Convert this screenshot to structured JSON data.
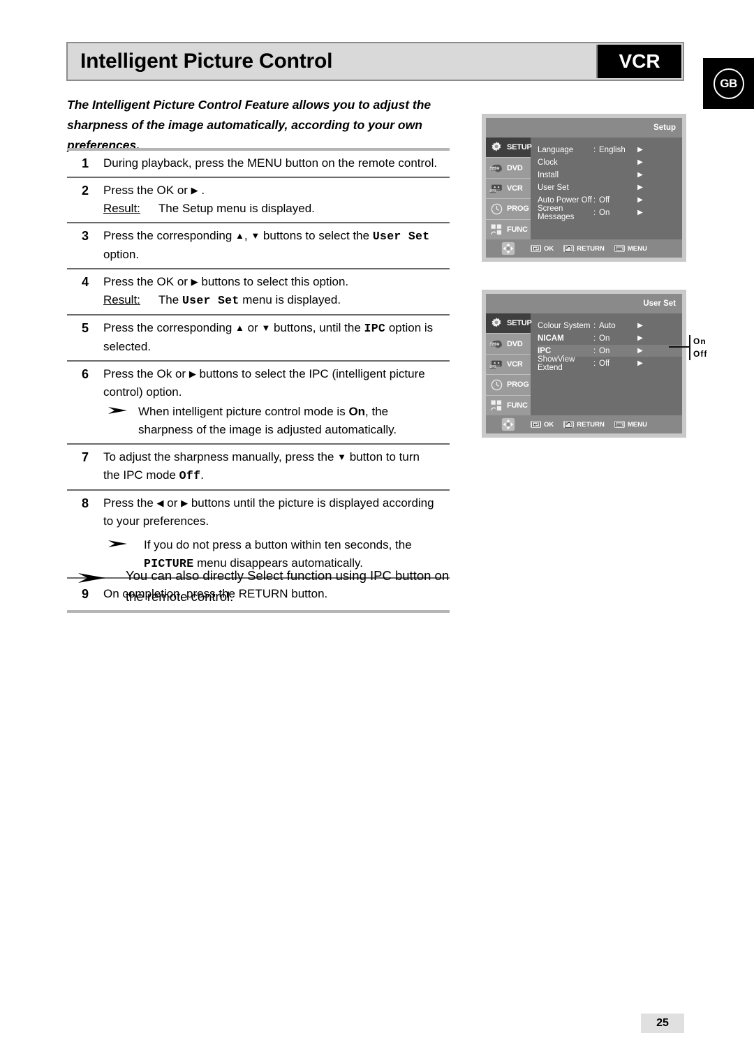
{
  "header": {
    "title": "Intelligent Picture Control",
    "device": "VCR",
    "region": "GB"
  },
  "intro": "The Intelligent Picture Control Feature allows you to adjust the sharpness of the image automatically, according to your own preferences.",
  "steps": [
    {
      "num": "1",
      "lines": [
        {
          "text": "During playback, press the MENU button on the remote control."
        }
      ]
    },
    {
      "num": "2",
      "lines": [
        {
          "pre": "Press the OK or ",
          "icon": "right-arrow",
          "post": " ."
        },
        {
          "result_label": "Result:",
          "result_text": "The Setup menu is displayed."
        }
      ]
    },
    {
      "num": "3",
      "lines": [
        {
          "pre": "Press the corresponding ",
          "icon": "up-arrow",
          "mid": ", ",
          "icon2": "down-arrow",
          "post": " buttons to select the ",
          "mono": "User Set"
        },
        {
          "text": "option."
        }
      ]
    },
    {
      "num": "4",
      "lines": [
        {
          "pre": "Press the OK or ",
          "icon": "right-arrow",
          "post": " buttons to select this option."
        },
        {
          "result_label": "Result:",
          "result_pre": "The ",
          "result_mono": "User Set",
          "result_post": " menu is displayed."
        }
      ]
    },
    {
      "num": "5",
      "lines": [
        {
          "pre": "Press the corresponding ",
          "icon": "up-arrow",
          "mid": " or ",
          "icon2": "down-arrow",
          "post": " buttons, until the ",
          "mono": "IPC",
          "tail": " option is"
        },
        {
          "text": "selected."
        }
      ]
    },
    {
      "num": "6",
      "lines": [
        {
          "pre": "Press the Ok or ",
          "icon": "right-arrow",
          "post": " buttons to select the IPC (intelligent picture"
        },
        {
          "text": "control) option."
        }
      ],
      "note": {
        "line1_pre": "When intelligent picture control mode is ",
        "line1_bold": "On",
        "line1_post": ", the",
        "line2": "sharpness of the image is adjusted automatically."
      }
    },
    {
      "num": "7",
      "lines": [
        {
          "pre": "To adjust the sharpness manually, press the ",
          "icon": "down-arrow",
          "post": " button to turn"
        },
        {
          "pre2": "the IPC mode ",
          "mono": "Off",
          "tail": "."
        }
      ]
    },
    {
      "num": "8",
      "lines": [
        {
          "pre": "Press the ",
          "icon": "left-arrow",
          "mid": " or ",
          "icon2": "right-arrow",
          "post": " buttons until the picture is displayed according"
        },
        {
          "text": "to your preferences."
        }
      ],
      "note": {
        "line1": "If you do not press a button within ten seconds, the",
        "line2_mono": "PICTURE",
        "line2_post": " menu disappears automatically."
      }
    },
    {
      "num": "9",
      "lines": [
        {
          "text": "On completion, press the RETURN button."
        }
      ]
    }
  ],
  "final_tip": "You can also directly Select function using IPC button on the remote control.",
  "osd_setup": {
    "title": "Setup",
    "sidebar": [
      {
        "label": "SETUP",
        "icon": "gear-icon",
        "active": true
      },
      {
        "label": "DVD",
        "icon": "disc-icon",
        "active": false
      },
      {
        "label": "VCR",
        "icon": "cassette-icon",
        "active": false
      },
      {
        "label": "PROG",
        "icon": "clock-icon",
        "active": false
      },
      {
        "label": "FUNC",
        "icon": "function-icon",
        "active": false
      }
    ],
    "rows": [
      {
        "name": "Language",
        "colon": ":",
        "value": "English",
        "arrow": "▶"
      },
      {
        "name": "Clock",
        "colon": "",
        "value": "",
        "arrow": "▶"
      },
      {
        "name": "Install",
        "colon": "",
        "value": "",
        "arrow": "▶"
      },
      {
        "name": "User Set",
        "colon": "",
        "value": "",
        "arrow": "▶"
      },
      {
        "name": "Auto Power Off",
        "colon": ":",
        "value": "Off",
        "arrow": "▶"
      },
      {
        "name": "Screen Messages",
        "colon": ":",
        "value": "On",
        "arrow": "▶"
      }
    ],
    "bottom": [
      {
        "label": "OK",
        "icon": "ok-chip-icon"
      },
      {
        "label": "RETURN",
        "icon": "return-chip-icon"
      },
      {
        "label": "MENU",
        "icon": "menu-chip-icon"
      }
    ]
  },
  "osd_userset": {
    "title": "User Set",
    "sidebar": [
      {
        "label": "SETUP",
        "icon": "gear-icon",
        "active": true
      },
      {
        "label": "DVD",
        "icon": "disc-icon",
        "active": false
      },
      {
        "label": "VCR",
        "icon": "cassette-icon",
        "active": false
      },
      {
        "label": "PROG",
        "icon": "clock-icon",
        "active": false
      },
      {
        "label": "FUNC",
        "icon": "function-icon",
        "active": false
      }
    ],
    "rows": [
      {
        "name": "Colour  System",
        "colon": ":",
        "value": "Auto",
        "arrow": "▶",
        "bold": false,
        "highlight": false
      },
      {
        "name": "NICAM",
        "colon": ":",
        "value": "On",
        "arrow": "▶",
        "bold": true,
        "highlight": false
      },
      {
        "name": "IPC",
        "colon": ":",
        "value": "On",
        "arrow": "▶",
        "bold": true,
        "highlight": true
      },
      {
        "name": "ShowView Extend",
        "colon": ":",
        "value": "Off",
        "arrow": "▶",
        "bold": false,
        "highlight": false
      }
    ],
    "bottom": [
      {
        "label": "OK",
        "icon": "ok-chip-icon"
      },
      {
        "label": "RETURN",
        "icon": "return-chip-icon"
      },
      {
        "label": "MENU",
        "icon": "menu-chip-icon"
      }
    ],
    "callout": {
      "on": "On",
      "off": "Off"
    }
  },
  "page_number": "25"
}
